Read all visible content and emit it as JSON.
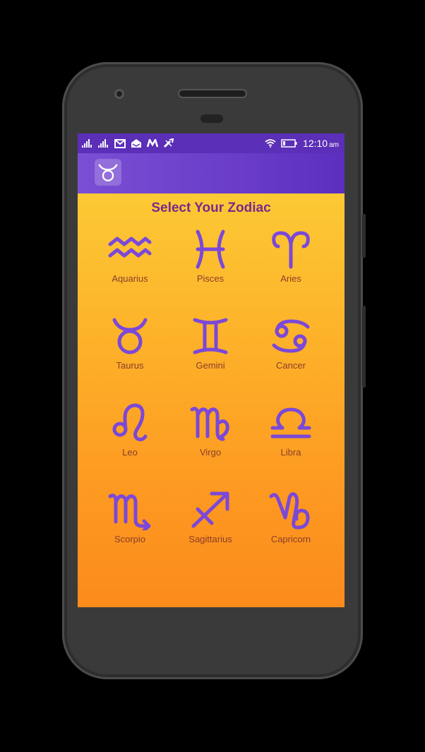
{
  "status_bar": {
    "time": "12:10",
    "ampm": "am",
    "carrier_icons": [
      "signal-icon",
      "signal-icon",
      "mail-icon",
      "inbox-icon",
      "m-logo-icon",
      "tool-icon"
    ],
    "right_icons": [
      "wifi-icon",
      "battery-icon"
    ]
  },
  "app_bar": {
    "logo_icon": "taurus-icon"
  },
  "main": {
    "title": "Select Your Zodiac",
    "signs": [
      {
        "label": "Aquarius",
        "icon": "aquarius-icon"
      },
      {
        "label": "Pisces",
        "icon": "pisces-icon"
      },
      {
        "label": "Aries",
        "icon": "aries-icon"
      },
      {
        "label": "Taurus",
        "icon": "taurus-icon"
      },
      {
        "label": "Gemini",
        "icon": "gemini-icon"
      },
      {
        "label": "Cancer",
        "icon": "cancer-icon"
      },
      {
        "label": "Leo",
        "icon": "leo-icon"
      },
      {
        "label": "Virgo",
        "icon": "virgo-icon"
      },
      {
        "label": "Libra",
        "icon": "libra-icon"
      },
      {
        "label": "Scorpio",
        "icon": "scorpio-icon"
      },
      {
        "label": "Sagittarius",
        "icon": "sagittarius-icon"
      },
      {
        "label": "Capricorn",
        "icon": "capricorn-icon"
      }
    ]
  },
  "colors": {
    "status_bar": "#5b2fb7",
    "app_bar": "#6a3cc8",
    "background_top": "#fcc934",
    "background_bottom": "#fc8b1c",
    "icon": "#7b48d8",
    "title": "#7a2a8c",
    "label": "#8a3d2a"
  }
}
